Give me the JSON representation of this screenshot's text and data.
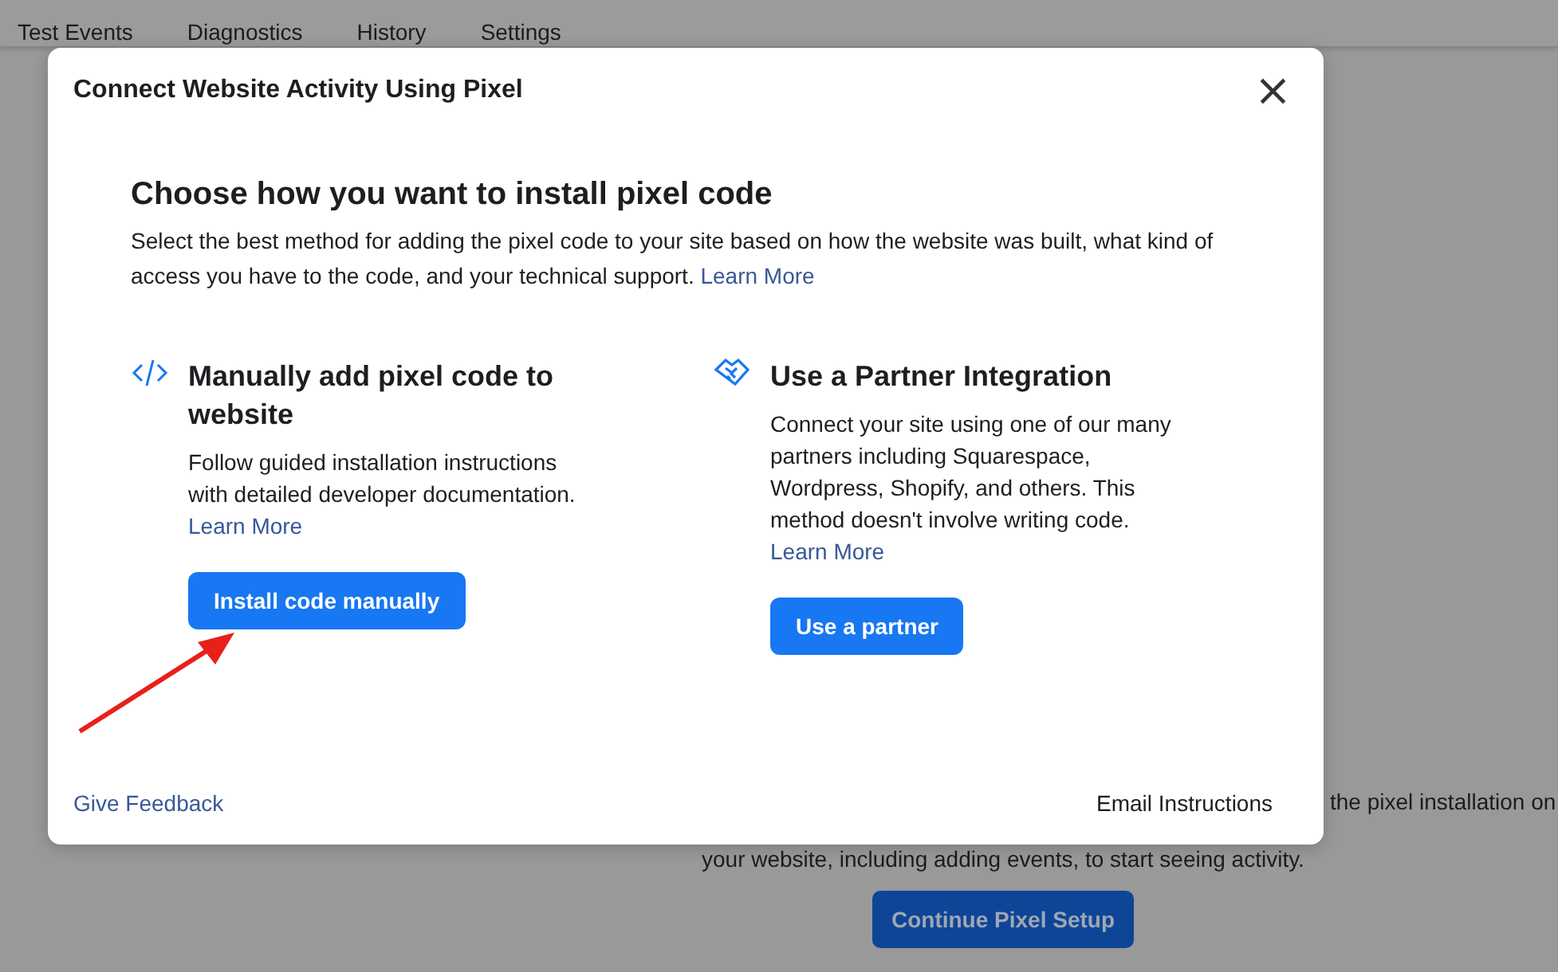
{
  "background": {
    "tabs": [
      {
        "label": "Test Events"
      },
      {
        "label": "Diagnostics"
      },
      {
        "label": "History"
      },
      {
        "label": "Settings"
      }
    ],
    "text_lines": [
      "the pixel installation on",
      "your website, including adding events, to start seeing activity."
    ],
    "button": "Continue Pixel Setup"
  },
  "dialog": {
    "title": "Connect Website Activity Using Pixel",
    "close": "×",
    "heading": "Choose how you want to install pixel code",
    "description": "Select the best method for adding the pixel code to your site based on how the website was built, what kind of access you have to the code, and your technical support.",
    "description_link": "Learn More",
    "options": [
      {
        "kind": "code",
        "title": "Manually add pixel code to website",
        "text": "Follow guided installation instructions with detailed developer documentation.",
        "link": "Learn More",
        "button": "Install code manually"
      },
      {
        "kind": "partner",
        "title": "Use a Partner Integration",
        "text": "Connect your site using one of our many partners including Squarespace, Wordpress, Shopify, and others. This method doesn't involve writing code.",
        "link": "Learn More",
        "button": "Use a partner"
      }
    ],
    "footer_link": "Give Feedback",
    "footer_action": "Email Instructions"
  }
}
